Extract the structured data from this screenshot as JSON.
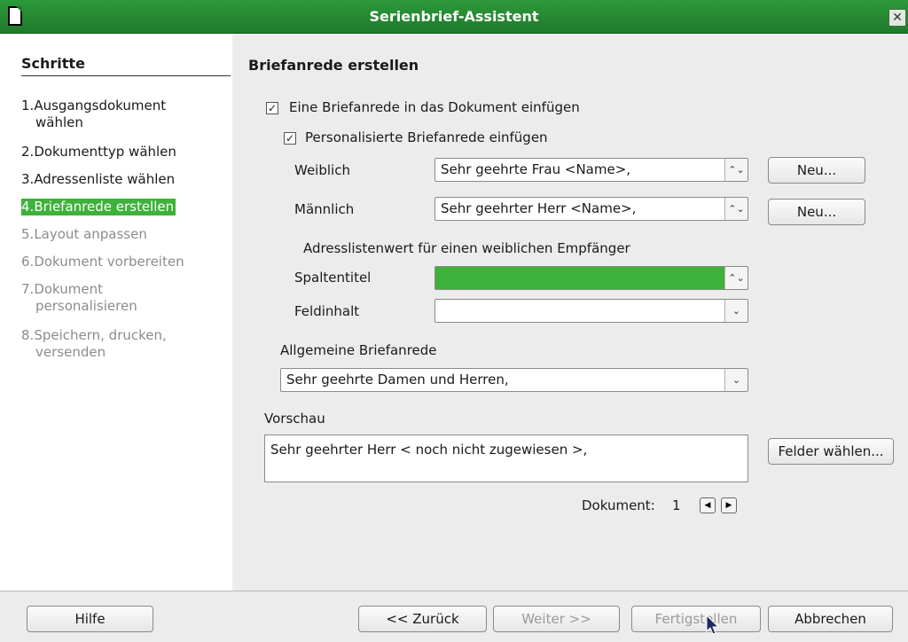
{
  "window": {
    "title": "Serienbrief-Assistent",
    "close_label": "x"
  },
  "steps": {
    "title": "Schritte",
    "items": [
      {
        "num": "1.",
        "line1": "Ausgangsdokument",
        "line2": "wählen",
        "state": "done"
      },
      {
        "num": "2.",
        "line1": "Dokumenttyp wählen",
        "line2": "",
        "state": "done"
      },
      {
        "num": "3.",
        "line1": "Adressenliste wählen",
        "line2": "",
        "state": "done"
      },
      {
        "num": "4.",
        "line1": "Briefanrede erstellen",
        "line2": "",
        "state": "active"
      },
      {
        "num": "5.",
        "line1": "Layout anpassen",
        "line2": "",
        "state": "disabled"
      },
      {
        "num": "6.",
        "line1": "Dokument vorbereiten",
        "line2": "",
        "state": "disabled"
      },
      {
        "num": "7.",
        "line1": "Dokument",
        "line2": "personalisieren",
        "state": "disabled"
      },
      {
        "num": "8.",
        "line1": "Speichern, drucken,",
        "line2": "versenden",
        "state": "disabled"
      }
    ]
  },
  "page": {
    "title": "Briefanrede erstellen",
    "insert_salutation": {
      "label": "Eine Briefanrede in das Dokument einfügen",
      "checked": true
    },
    "personalized": {
      "label": "Personalisierte Briefanrede einfügen",
      "checked": true
    },
    "female": {
      "label": "Weiblich",
      "value": "Sehr geehrte Frau <Name>,",
      "new_button": "Neu..."
    },
    "male": {
      "label": "Männlich",
      "value": "Sehr geehrter Herr <Name>,",
      "new_button": "Neu..."
    },
    "address_section": "Adresslistenwert für einen weiblichen Empfänger",
    "column_title": {
      "label": "Spaltentitel",
      "value": ""
    },
    "field_content": {
      "label": "Feldinhalt",
      "value": ""
    },
    "general": {
      "label": "Allgemeine Briefanrede",
      "value": "Sehr geehrte Damen und Herren,"
    },
    "preview": {
      "label": "Vorschau",
      "text": "Sehr geehrter Herr < noch nicht zugewiesen >,",
      "fields_button": "Felder wählen..."
    },
    "document": {
      "label": "Dokument:",
      "number": "1"
    }
  },
  "footer": {
    "help": "Hilfe",
    "back": "<< Zurück",
    "next": "Weiter >>",
    "finish": "Fertigstellen",
    "cancel": "Abbrechen"
  },
  "colors": {
    "accent": "#3eb13a",
    "titlebar": "#2e9a3a",
    "panel": "#ececec"
  },
  "icons": {
    "app": "document-icon",
    "close": "close-icon",
    "spin": "up-down-icon",
    "dropdown": "chevron-down-icon",
    "prev": "triangle-left-icon",
    "next": "triangle-right-icon"
  }
}
